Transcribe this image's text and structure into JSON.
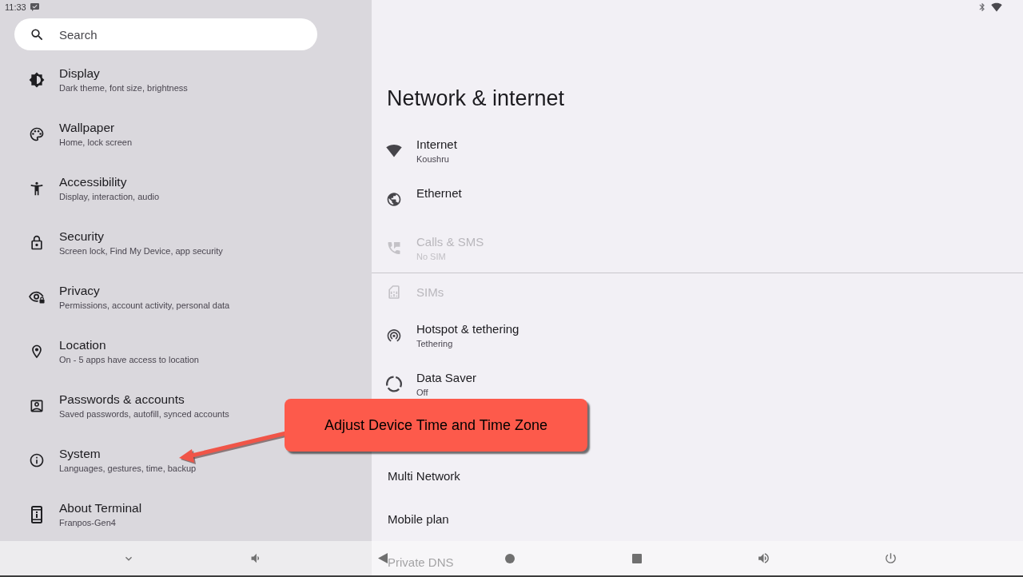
{
  "status_bar": {
    "time": "11:33"
  },
  "search": {
    "placeholder": "Search"
  },
  "sidebar": {
    "items": [
      {
        "title": "Display",
        "subtitle": "Dark theme, font size, brightness"
      },
      {
        "title": "Wallpaper",
        "subtitle": "Home, lock screen"
      },
      {
        "title": "Accessibility",
        "subtitle": "Display, interaction, audio"
      },
      {
        "title": "Security",
        "subtitle": "Screen lock, Find My Device, app security"
      },
      {
        "title": "Privacy",
        "subtitle": "Permissions, account activity, personal data"
      },
      {
        "title": "Location",
        "subtitle": "On - 5 apps have access to location"
      },
      {
        "title": "Passwords & accounts",
        "subtitle": "Saved passwords, autofill, synced accounts"
      },
      {
        "title": "System",
        "subtitle": "Languages, gestures, time, backup"
      },
      {
        "title": "About Terminal",
        "subtitle": "Franpos-Gen4"
      }
    ]
  },
  "page": {
    "title": "Network & internet",
    "items": [
      {
        "kind": "icon",
        "title": "Internet",
        "subtitle": "Koushru",
        "disabled": false,
        "divider_before": false
      },
      {
        "kind": "icon",
        "title": "Ethernet",
        "disabled": false,
        "divider_before": false
      },
      {
        "kind": "icon",
        "title": "Calls & SMS",
        "subtitle": "No SIM",
        "disabled": true,
        "divider_before": false
      },
      {
        "kind": "icon",
        "title": "SIMs",
        "disabled": true,
        "divider_before": true
      },
      {
        "kind": "icon",
        "title": "Hotspot & tethering",
        "subtitle": "Tethering",
        "disabled": false,
        "divider_before": false
      },
      {
        "kind": "icon",
        "title": "Data Saver",
        "subtitle": "Off",
        "disabled": false,
        "divider_before": false
      },
      {
        "kind": "plain",
        "title": "Multi Network",
        "disabled": false,
        "divider_before": false
      },
      {
        "kind": "plain",
        "title": "Mobile plan",
        "disabled": false,
        "divider_before": false
      },
      {
        "kind": "plain",
        "title": "Private DNS",
        "disabled": false,
        "divider_before": false
      }
    ]
  },
  "annotation": {
    "text": "Adjust Device Time and Time Zone"
  }
}
